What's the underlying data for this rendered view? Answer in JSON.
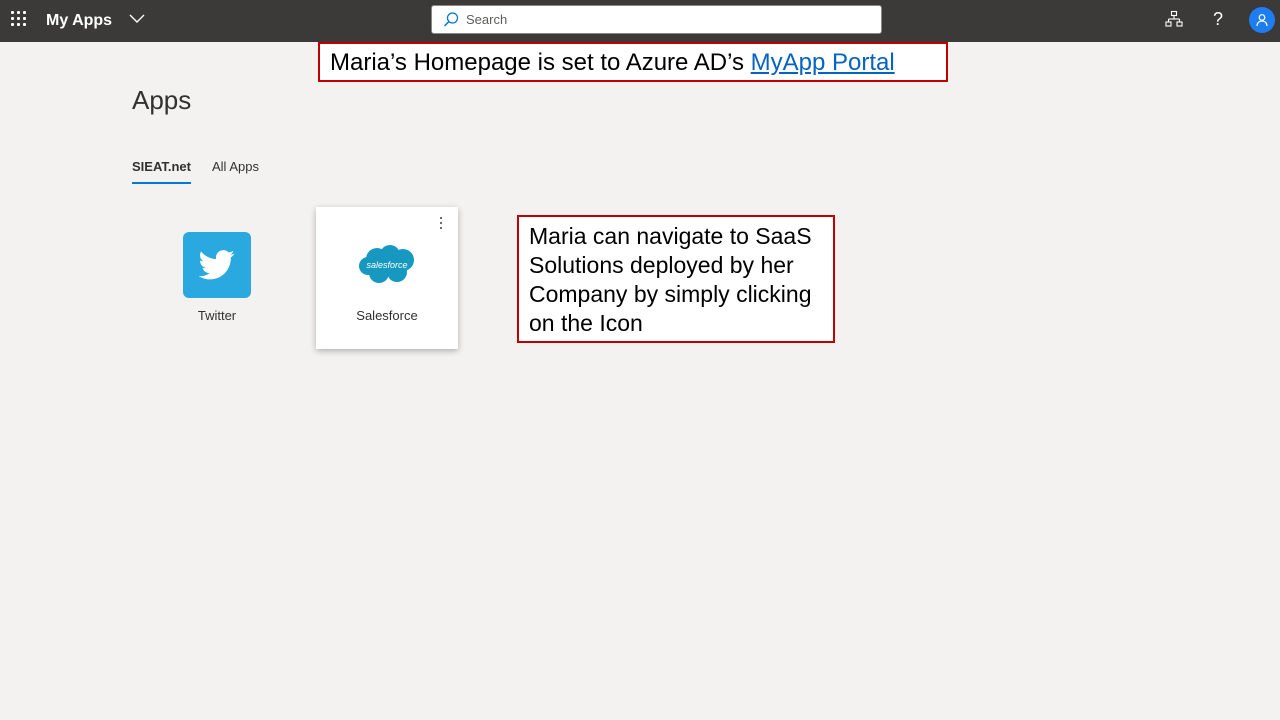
{
  "header": {
    "app_title": "My Apps",
    "search_placeholder": "Search",
    "search_value": "",
    "help_label": "?"
  },
  "page": {
    "title": "Apps",
    "tabs": [
      {
        "label": "SIEAT.net",
        "active": true
      },
      {
        "label": "All Apps",
        "active": false
      }
    ]
  },
  "apps": [
    {
      "name": "Twitter",
      "icon": "twitter-bird-icon",
      "color": "#2aa9e0"
    },
    {
      "name": "Salesforce",
      "icon": "salesforce-cloud-icon",
      "logo_text": "salesforce",
      "color": "#1798c1"
    }
  ],
  "annotations": {
    "top": {
      "text": "Maria’s Homepage is set to Azure AD’s ",
      "link_text": "MyApp Portal"
    },
    "side": {
      "text": "Maria can navigate to SaaS Solutions deployed by her Company by simply clicking on the Icon"
    }
  },
  "colors": {
    "topbar": "#3b3a39",
    "background": "#f3f2f1",
    "accent": "#0078d4",
    "avatar": "#1e7ef1",
    "callout_border": "#c00000",
    "link": "#0563c1"
  }
}
